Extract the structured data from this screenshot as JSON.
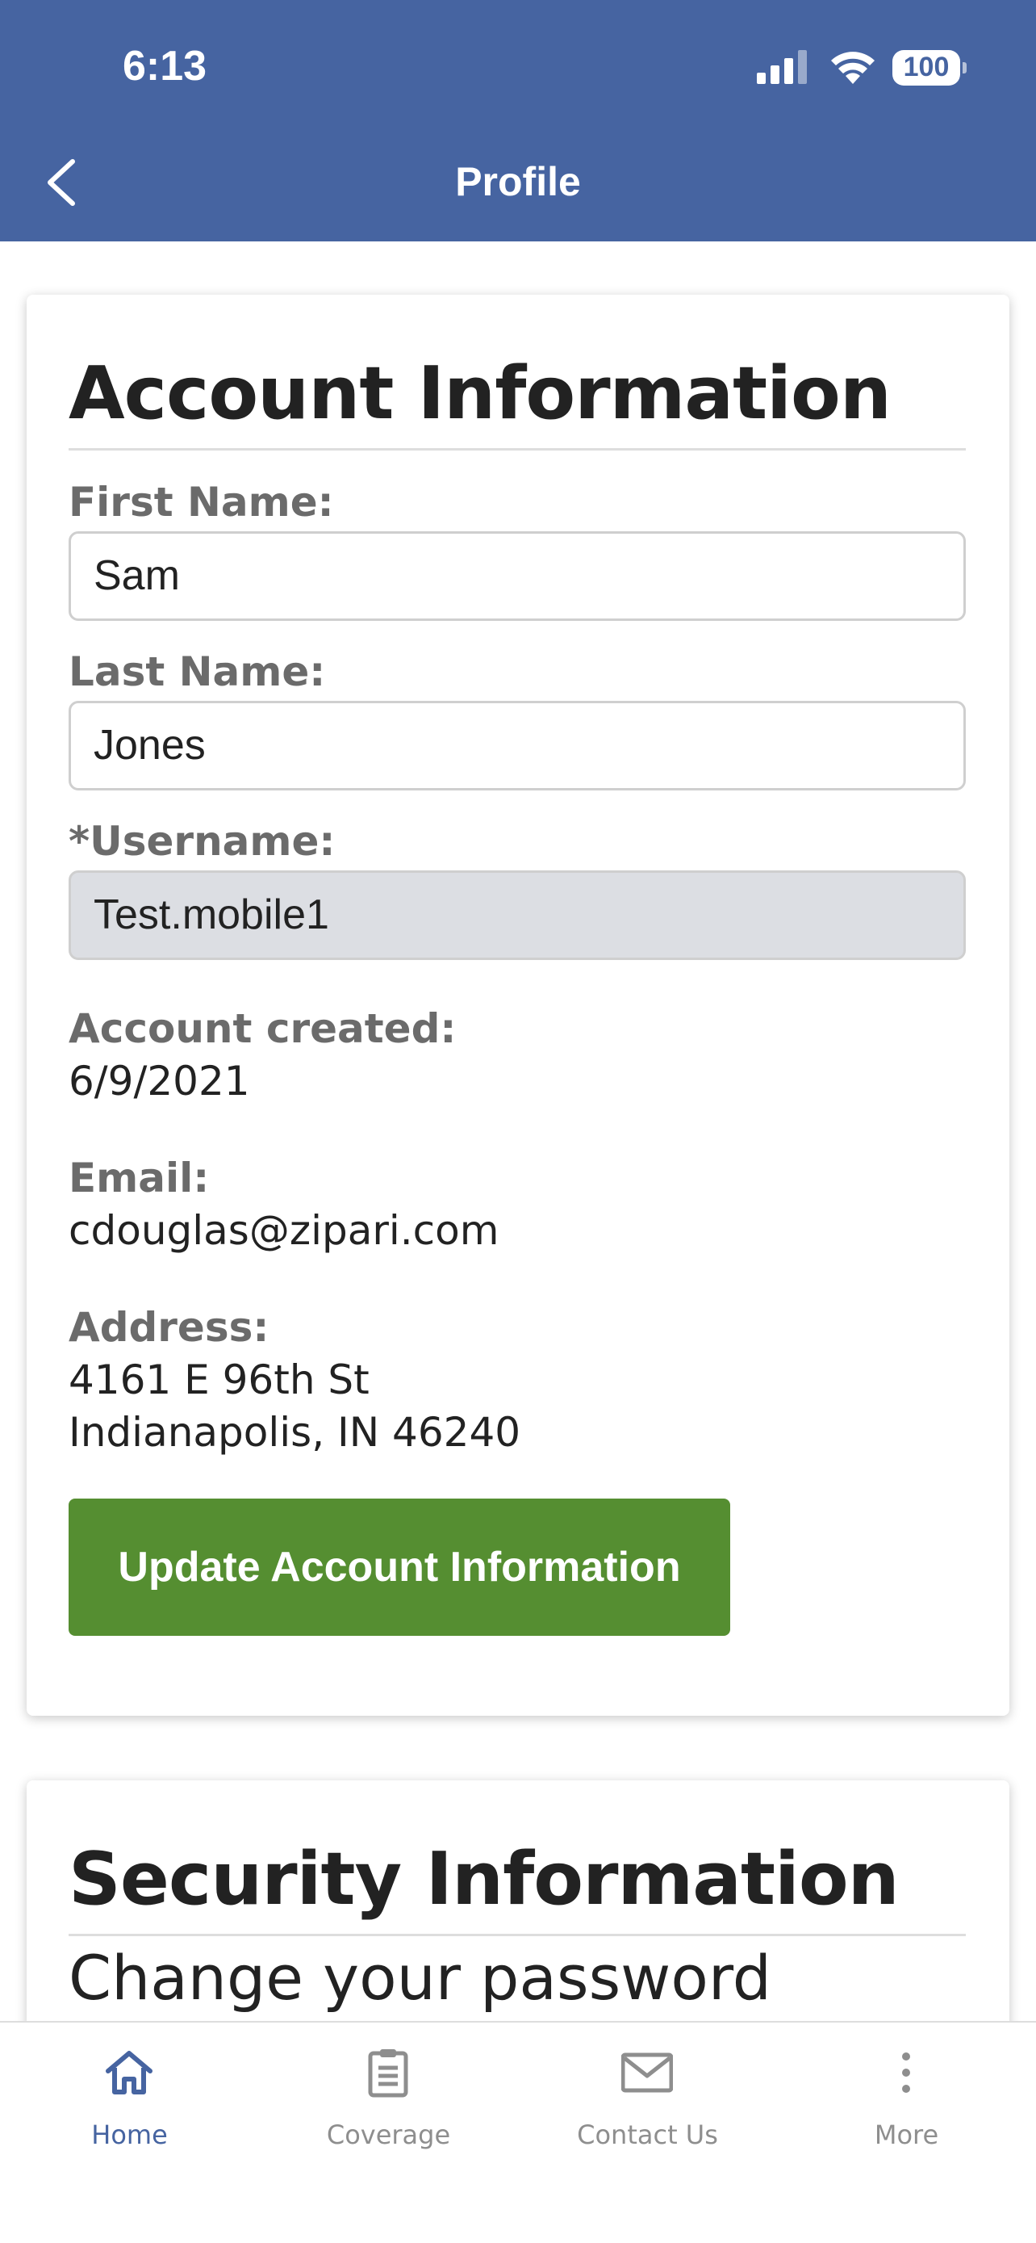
{
  "status_bar": {
    "time": "6:13",
    "battery": "100"
  },
  "nav": {
    "title": "Profile"
  },
  "account": {
    "title": "Account Information",
    "first_name_label": "First Name:",
    "first_name_value": "Sam",
    "last_name_label": "Last Name:",
    "last_name_value": "Jones",
    "username_label": "*Username:",
    "username_value": "Test.mobile1",
    "created_label": "Account created:",
    "created_value": "6/9/2021",
    "email_label": "Email:",
    "email_value": "cdouglas@zipari.com",
    "address_label": "Address:",
    "address_line1": "4161 E 96th St",
    "address_line2": "Indianapolis, IN 46240",
    "update_button": "Update Account Information",
    "button_color": "#558e31"
  },
  "security": {
    "title": "Security Information",
    "subtitle": "Change your password"
  },
  "tabs": [
    {
      "label": "Home",
      "icon": "home-icon",
      "active": true
    },
    {
      "label": "Coverage",
      "icon": "clipboard-icon",
      "active": false
    },
    {
      "label": "Contact Us",
      "icon": "mail-icon",
      "active": false
    },
    {
      "label": "More",
      "icon": "more-vertical-icon",
      "active": false
    }
  ],
  "colors": {
    "brand": "#4664a1",
    "tab_active": "#4664a1",
    "tab_inactive": "#8e8e8e"
  }
}
